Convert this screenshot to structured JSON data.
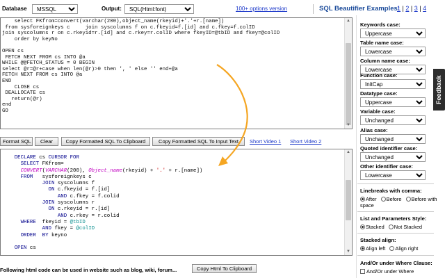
{
  "header": {
    "database_label": "Database",
    "database_value": "MSSQL",
    "output_label": "Output:",
    "output_value": "SQL(Html:font)",
    "options_link": "100+ options version",
    "examples_title": "SQL Beautifier Examples:",
    "example_links": [
      "1",
      "2",
      "3",
      "4"
    ]
  },
  "input_code": [
    "    select FKfrom=convert(varchar(200),object_name(rkeyid)+'.'+r.[name])",
    " from sysforeignkeys c     join syscolumns f on c.fkeyid=f.[id] and c.fkey=f.colID",
    "join syscolumns r on c.rkeyid=r.[id] and c.rkey=r.colID where fkeyID=@tbID and fkey=@colID",
    "    order by keyNo",
    "",
    "OPEN cs",
    " FETCH NEXT FROM cs INTO @a",
    "WHILE @@FETCH_STATUS = 0 BEGIN",
    "select @r=@r+case when len(@r)>0 then ', ' else '' end+@a",
    "FETCH NEXT FROM cs INTO @a",
    "END",
    "    CLOSE cs",
    " DEALLOCATE cs",
    "   return(@r)",
    "end",
    "GO"
  ],
  "toolbar": {
    "format": "Format SQL",
    "clear": "Clear",
    "copy_clipboard": "Copy Formatted SQL To Clipboard",
    "copy_input": "Copy Formatted SQL To Input Text",
    "video1": "Short Video 1",
    "video2": "Short Video 2"
  },
  "output_lines": [
    [
      {
        "t": "    DECLARE ",
        "c": "kw"
      },
      {
        "t": "cs ",
        "c": "ident"
      },
      {
        "t": "CURSOR FOR",
        "c": "kw"
      }
    ],
    [
      {
        "t": "      SELECT ",
        "c": "kw"
      },
      {
        "t": "FKfrom",
        "c": "ident"
      },
      {
        "t": "=",
        "c": "ident"
      }
    ],
    [
      {
        "t": "      ",
        "c": "ident"
      },
      {
        "t": "CONVERT",
        "c": "fn"
      },
      {
        "t": "(",
        "c": "ident"
      },
      {
        "t": "VARCHAR",
        "c": "fn"
      },
      {
        "t": "(200), ",
        "c": "ident"
      },
      {
        "t": "Object_name",
        "c": "fn"
      },
      {
        "t": "(rkeyid) + ",
        "c": "ident"
      },
      {
        "t": "'.'",
        "c": "str"
      },
      {
        "t": " + r.[name])",
        "c": "ident"
      }
    ],
    [
      {
        "t": "      FROM   ",
        "c": "kw"
      },
      {
        "t": "sysforeignkeys c",
        "c": "ident"
      }
    ],
    [
      {
        "t": "             JOIN ",
        "c": "kw"
      },
      {
        "t": "syscolumns f",
        "c": "ident"
      }
    ],
    [
      {
        "t": "               ON ",
        "c": "kw"
      },
      {
        "t": "c.fkeyid = f.[id]",
        "c": "ident"
      }
    ],
    [
      {
        "t": "                  AND ",
        "c": "kw"
      },
      {
        "t": "c.fkey = f.colid",
        "c": "ident"
      }
    ],
    [
      {
        "t": "             JOIN ",
        "c": "kw"
      },
      {
        "t": "syscolumns r",
        "c": "ident"
      }
    ],
    [
      {
        "t": "               ON ",
        "c": "kw"
      },
      {
        "t": "c.rkeyid = r.[id]",
        "c": "ident"
      }
    ],
    [
      {
        "t": "                  AND ",
        "c": "kw"
      },
      {
        "t": "c.rkey = r.colid",
        "c": "ident"
      }
    ],
    [
      {
        "t": "      WHERE  ",
        "c": "kw"
      },
      {
        "t": "fkeyid = ",
        "c": "ident"
      },
      {
        "t": "@tbID",
        "c": "var"
      }
    ],
    [
      {
        "t": "             AND ",
        "c": "kw"
      },
      {
        "t": "fkey = ",
        "c": "ident"
      },
      {
        "t": "@colID",
        "c": "var"
      }
    ],
    [
      {
        "t": "      ORDER  BY ",
        "c": "kw"
      },
      {
        "t": "keyno",
        "c": "ident"
      }
    ],
    [
      {
        "t": "",
        "c": "ident"
      }
    ],
    [
      {
        "t": "    OPEN ",
        "c": "kw"
      },
      {
        "t": "cs",
        "c": "ident"
      }
    ]
  ],
  "footer": {
    "note": "Following html code can be used in website such as blog, wiki, forum...",
    "copy_html": "Copy Html To Clipboard"
  },
  "sidebar": {
    "keywords_label": "Keywords case:",
    "keywords_value": "Uppercase",
    "table_label": "Table name case:",
    "table_value": "Lowercase",
    "column_label": "Column name case:",
    "column_value": "Lowercase",
    "function_label": "Function case:",
    "function_value": "InitCap",
    "datatype_label": "Datatype case:",
    "datatype_value": "Uppercase",
    "variable_label": "Variable case:",
    "variable_value": "Unchanged",
    "alias_label": "Alias case:",
    "alias_value": "Unchanged",
    "quoted_label": "Quoted identifier case:",
    "quoted_value": "Unchanged",
    "other_label": "Other identifier case:",
    "other_value": "Lowercase",
    "linebreaks_label": "Linebreaks with comma:",
    "linebreaks_after": "After",
    "linebreaks_before": "Before",
    "linebreaks_before_space": "Before with space",
    "list_label": "List and Parameters Style:",
    "list_stacked": "Stacked",
    "list_not_stacked": "Not Stacked",
    "stacked_align_label": "Stacked align:",
    "align_left": "Align left",
    "align_right": "Align right",
    "andor_label": "And/Or under Where Clause:",
    "andor_option": "And/Or under Where"
  },
  "feedback": "Feedback",
  "colors": {
    "keyword": "#00008b",
    "function": "#c000c0",
    "string": "#cc0000",
    "variable": "#008b8b",
    "arrow": "#f5a623"
  }
}
